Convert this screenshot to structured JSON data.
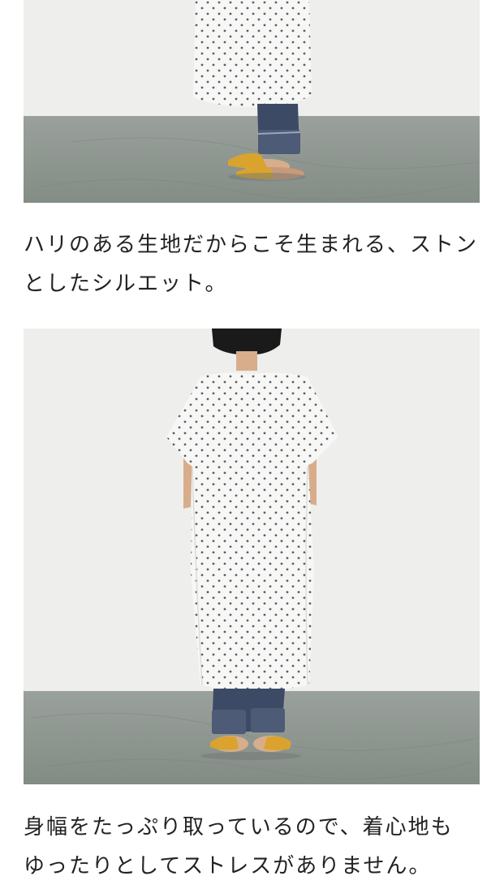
{
  "article": {
    "captions": [
      {
        "line1": "ハリのある生地だからこそ生まれる、ストン",
        "line2": "としたシルエット。"
      },
      {
        "line1": "身幅をたっぷり取っているので、着心地も",
        "line2": "ゆったりとしてストレスがありません。"
      }
    ]
  },
  "colors": {
    "wall": "#eeeeec",
    "floor": "#8f9791",
    "dress": "#f7f7f5",
    "dots": "#5a5d6a",
    "denim": "#3c4a66",
    "sandal": "#d9a32e",
    "skin": "#d8ad8c",
    "hair": "#1a1a1a",
    "text": "#222222"
  }
}
